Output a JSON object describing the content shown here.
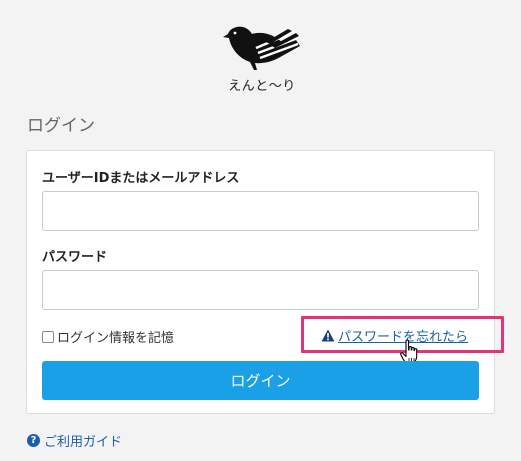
{
  "brand": {
    "logo_icon": "bird-icon",
    "name": "えんと〜り"
  },
  "page_title": "ログイン",
  "form": {
    "user_label": "ユーザーIDまたはメールアドレス",
    "user_value": "",
    "password_label": "パスワード",
    "password_value": "",
    "remember_label": "ログイン情報を記憶",
    "remember_checked": false,
    "forgot_label": "パスワードを忘れたら",
    "forgot_icon": "warning-icon",
    "submit_label": "ログイン"
  },
  "footer": {
    "guide_label": "ご利用ガイド",
    "guide_icon": "help-icon"
  },
  "colors": {
    "primary_button": "#1aa0e6",
    "link": "#1a5fa8",
    "highlight_border": "#e0357a",
    "background": "#f3f3f3"
  }
}
